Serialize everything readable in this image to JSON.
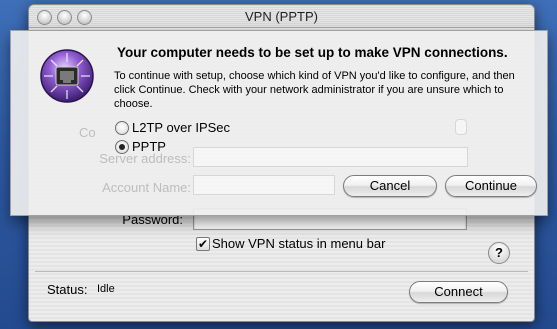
{
  "window": {
    "title": "VPN (PPTP)"
  },
  "form": {
    "password_label": "Password:",
    "show_status_label": "Show VPN status in menu bar",
    "show_status_checked": true,
    "status_label": "Status:",
    "status_value": "Idle",
    "connect_label": "Connect",
    "help_glyph": "?"
  },
  "sheet": {
    "title": "Your computer needs to be set up to make VPN connections.",
    "description": "To continue with setup, choose which kind of VPN you'd like to configure, and then click Continue. Check with your network administrator if you are unsure which to choose.",
    "options": [
      {
        "label": "L2TP over IPSec",
        "selected": false
      },
      {
        "label": "PPTP",
        "selected": true
      }
    ],
    "cancel_label": "Cancel",
    "continue_label": "Continue",
    "ghost_labels": [
      "Co",
      "Server address:",
      "Account Name:"
    ]
  }
}
